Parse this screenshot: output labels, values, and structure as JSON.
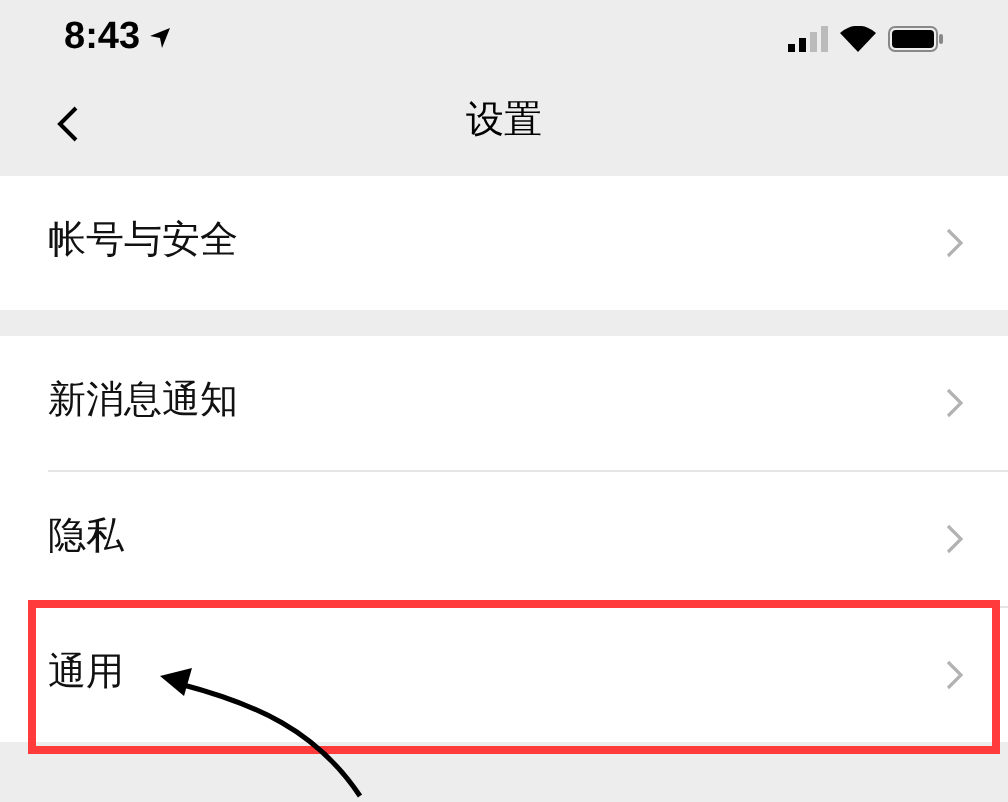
{
  "status_bar": {
    "time": "8:43"
  },
  "nav": {
    "title": "设置"
  },
  "groups": [
    {
      "items": [
        {
          "label": "帐号与安全",
          "highlighted": false
        }
      ]
    },
    {
      "items": [
        {
          "label": "新消息通知",
          "highlighted": false
        },
        {
          "label": "隐私",
          "highlighted": false
        },
        {
          "label": "通用",
          "highlighted": true
        }
      ]
    }
  ]
}
